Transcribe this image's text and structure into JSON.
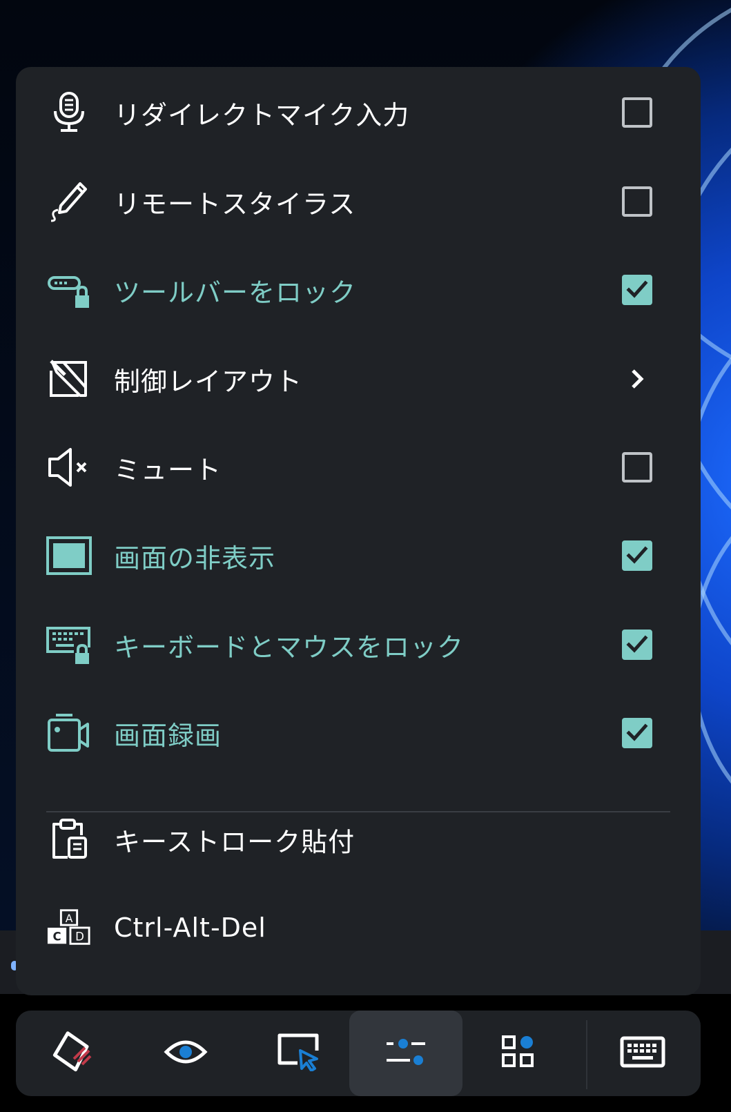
{
  "colors": {
    "accent": "#7fcdc6",
    "panel": "#1f2226",
    "text": "#ffffff",
    "blue": "#1a7fd4",
    "red": "#c23a4a"
  },
  "menu": {
    "items": [
      {
        "label": "リダイレクトマイク入力",
        "icon": "microphone-icon",
        "control": "checkbox",
        "checked": false
      },
      {
        "label": "リモートスタイラス",
        "icon": "stylus-pen-icon",
        "control": "checkbox",
        "checked": false
      },
      {
        "label": "ツールバーをロック",
        "icon": "toolbar-lock-icon",
        "control": "checkbox",
        "checked": true
      },
      {
        "label": "制御レイアウト",
        "icon": "control-layout-icon",
        "control": "submenu"
      },
      {
        "label": "ミュート",
        "icon": "speaker-mute-icon",
        "control": "checkbox",
        "checked": false
      },
      {
        "label": "画面の非表示",
        "icon": "screen-blank-icon",
        "control": "checkbox",
        "checked": true
      },
      {
        "label": "キーボードとマウスをロック",
        "icon": "keyboard-lock-icon",
        "control": "checkbox",
        "checked": true
      },
      {
        "label": "画面録画",
        "icon": "video-camera-icon",
        "control": "checkbox",
        "checked": true
      },
      {
        "label": "キーストローク貼付",
        "icon": "clipboard-icon",
        "control": "action"
      },
      {
        "label": "Ctrl-Alt-Del",
        "icon": "key-combo-icon",
        "control": "action"
      }
    ]
  },
  "toolbar": {
    "buttons": [
      {
        "icon": "draw-tool-icon",
        "active": false
      },
      {
        "icon": "eye-icon",
        "active": false
      },
      {
        "icon": "window-pointer-icon",
        "active": false
      },
      {
        "icon": "sliders-icon",
        "active": true
      },
      {
        "icon": "apps-grid-icon",
        "active": false
      },
      {
        "icon": "keyboard-icon",
        "active": false
      }
    ]
  }
}
